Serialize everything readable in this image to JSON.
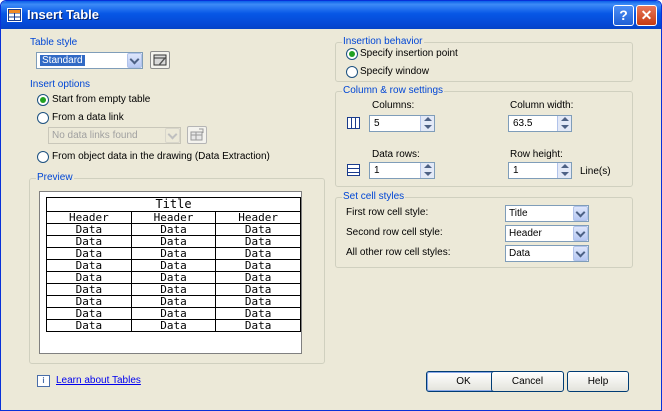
{
  "window": {
    "title": "Insert Table",
    "help_glyph": "?",
    "close_glyph": "✕",
    "icon": "table-app-icon"
  },
  "table_style": {
    "label": "Table style",
    "selected": "Standard",
    "edit_icon": "table-style-dialog-icon"
  },
  "insert_options": {
    "label": "Insert options",
    "start_empty": "Start from empty table",
    "from_link": "From a data link",
    "link_selected": "No data links found",
    "link_icon": "data-link-manager-icon",
    "from_object": "From object data in the drawing (Data Extraction)"
  },
  "preview": {
    "label": "Preview",
    "title": "Title",
    "headers": [
      "Header",
      "Header",
      "Header"
    ],
    "rows": [
      [
        "Data",
        "Data",
        "Data"
      ],
      [
        "Data",
        "Data",
        "Data"
      ],
      [
        "Data",
        "Data",
        "Data"
      ],
      [
        "Data",
        "Data",
        "Data"
      ],
      [
        "Data",
        "Data",
        "Data"
      ],
      [
        "Data",
        "Data",
        "Data"
      ],
      [
        "Data",
        "Data",
        "Data"
      ],
      [
        "Data",
        "Data",
        "Data"
      ],
      [
        "Data",
        "Data",
        "Data"
      ]
    ]
  },
  "insertion": {
    "label": "Insertion behavior",
    "point": "Specify insertion point",
    "window": "Specify window"
  },
  "column_row": {
    "label": "Column & row settings",
    "columns_label": "Columns:",
    "columns_value": "5",
    "column_width_label": "Column width:",
    "column_width_value": "63.5",
    "data_rows_label": "Data rows:",
    "data_rows_value": "1",
    "row_height_label": "Row height:",
    "row_height_value": "1",
    "row_height_unit": "Line(s)",
    "columns_icon": "columns-icon",
    "rows_icon": "rows-icon"
  },
  "cell_styles": {
    "label": "Set cell styles",
    "first_label": "First row cell style:",
    "first_value": "Title",
    "second_label": "Second row cell style:",
    "second_value": "Header",
    "other_label": "All other row cell styles:",
    "other_value": "Data"
  },
  "footer": {
    "info_glyph": "i",
    "learn_link": "Learn about Tables",
    "ok": "OK",
    "cancel": "Cancel",
    "help": "Help"
  }
}
